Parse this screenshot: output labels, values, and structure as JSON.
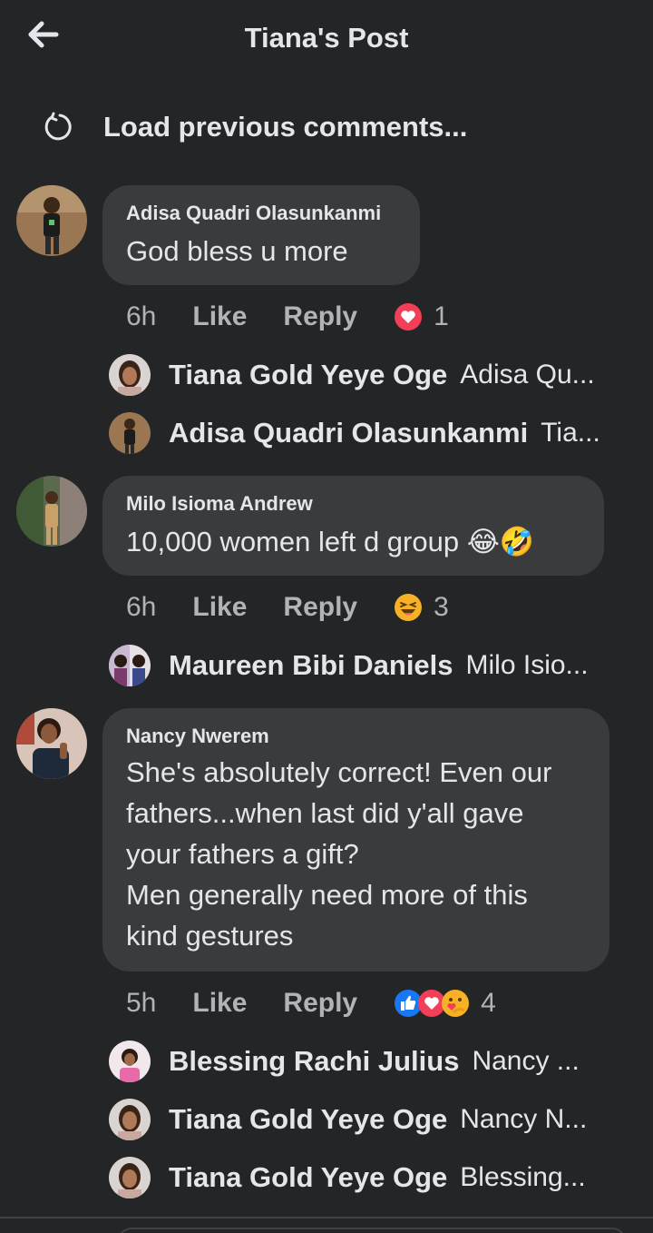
{
  "header": {
    "title": "Tiana's Post"
  },
  "load_previous": "Load previous comments...",
  "comments": [
    {
      "author": "Adisa Quadri Olasunkanmi",
      "text": "God bless u more",
      "time": "6h",
      "like": "Like",
      "reply": "Reply",
      "reaction_count": "1",
      "replies": [
        {
          "name": "Tiana Gold Yeye Oge",
          "text": "Adisa Qu..."
        },
        {
          "name": "Adisa Quadri Olasunkanmi",
          "text": "Tia..."
        }
      ]
    },
    {
      "author": "Milo Isioma Andrew",
      "text": "10,000 women left d group 😂🤣",
      "time": "6h",
      "like": "Like",
      "reply": "Reply",
      "reaction_count": "3",
      "replies": [
        {
          "name": "Maureen Bibi Daniels",
          "text": "Milo Isio..."
        }
      ]
    },
    {
      "author": "Nancy Nwerem",
      "text_lines": [
        "She's absolutely correct! Even our",
        "fathers...when last did y'all gave",
        "your fathers a gift?",
        "Men generally need more of this",
        "kind gestures"
      ],
      "time": "5h",
      "like": "Like",
      "reply": "Reply",
      "reaction_count": "4",
      "replies": [
        {
          "name": "Blessing Rachi Julius",
          "text": "Nancy ..."
        },
        {
          "name": "Tiana Gold Yeye Oge",
          "text": "Nancy N..."
        },
        {
          "name": "Tiana Gold Yeye Oge",
          "text": "Blessing..."
        }
      ]
    }
  ],
  "colors": {
    "background": "#242526",
    "bubble": "#3a3b3c",
    "text": "#e4e6eb",
    "muted": "#b0b3b8",
    "love": "#f33e58",
    "like": "#1877f2",
    "haha": "#f7b125"
  },
  "icons": {
    "back": "arrow-left-icon",
    "refresh": "refresh-icon"
  }
}
